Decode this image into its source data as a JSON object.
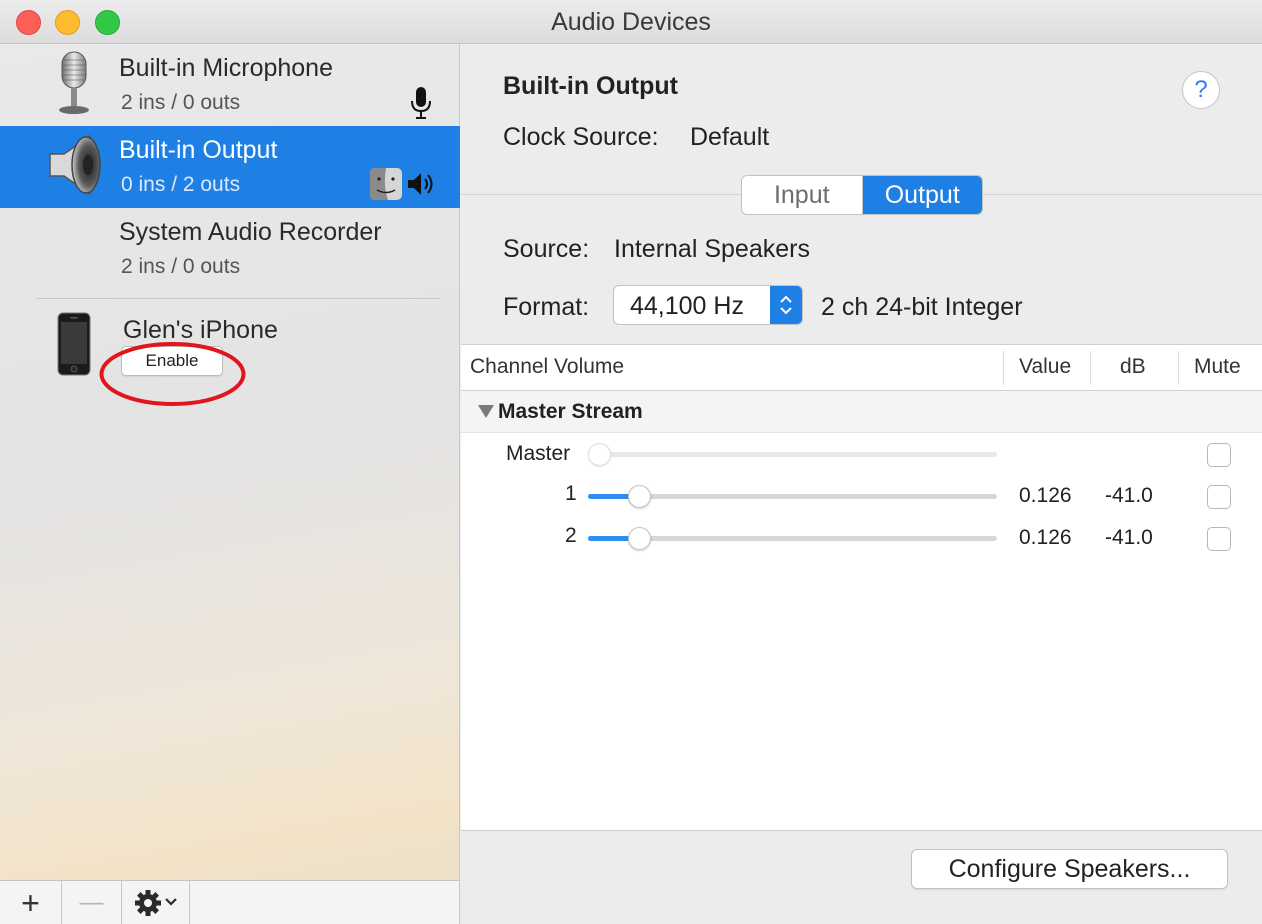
{
  "window": {
    "title": "Audio Devices",
    "controls": [
      "close",
      "minimize",
      "zoom"
    ]
  },
  "sidebar": {
    "devices": [
      {
        "name": "Built-in Microphone",
        "io": "2 ins / 0 outs",
        "icon": "microphone-icon",
        "badges": [
          "mic-badge-icon"
        ],
        "selected": false
      },
      {
        "name": "Built-in Output",
        "io": "0 ins / 2 outs",
        "icon": "speaker-icon",
        "badges": [
          "finder-icon",
          "volume-badge-icon"
        ],
        "selected": true
      },
      {
        "name": "System Audio Recorder",
        "io": "2 ins / 0 outs",
        "icon": "",
        "badges": [],
        "selected": false
      }
    ],
    "iphone": {
      "name": "Glen's iPhone",
      "enable_label": "Enable",
      "icon": "iphone-icon",
      "annotation": "red circle around Enable button"
    },
    "toolbar": {
      "add": "+",
      "remove": "—",
      "gear": "gear-icon"
    }
  },
  "detail": {
    "title": "Built-in Output",
    "help": "?",
    "clock_source_label": "Clock Source:",
    "clock_source_value": "Default",
    "tabs": {
      "input": "Input",
      "output": "Output",
      "selected": "Output"
    },
    "source_label": "Source:",
    "source_value": "Internal Speakers",
    "format_label": "Format:",
    "format_value": "44,100 Hz",
    "format_desc": "2 ch 24-bit Integer",
    "table": {
      "headers": {
        "channel": "Channel Volume",
        "value": "Value",
        "db": "dB",
        "mute": "Mute"
      },
      "group": "Master Stream",
      "rows": [
        {
          "label": "Master",
          "value": "",
          "db": "",
          "level": 0,
          "enabled": false
        },
        {
          "label": "1",
          "value": "0.126",
          "db": "-41.0",
          "level": 0.126,
          "enabled": true
        },
        {
          "label": "2",
          "value": "0.126",
          "db": "-41.0",
          "level": 0.126,
          "enabled": true
        }
      ]
    },
    "configure_label": "Configure Speakers..."
  },
  "colors": {
    "accent": "#1e7fe5",
    "annotation": "#e0161c"
  }
}
